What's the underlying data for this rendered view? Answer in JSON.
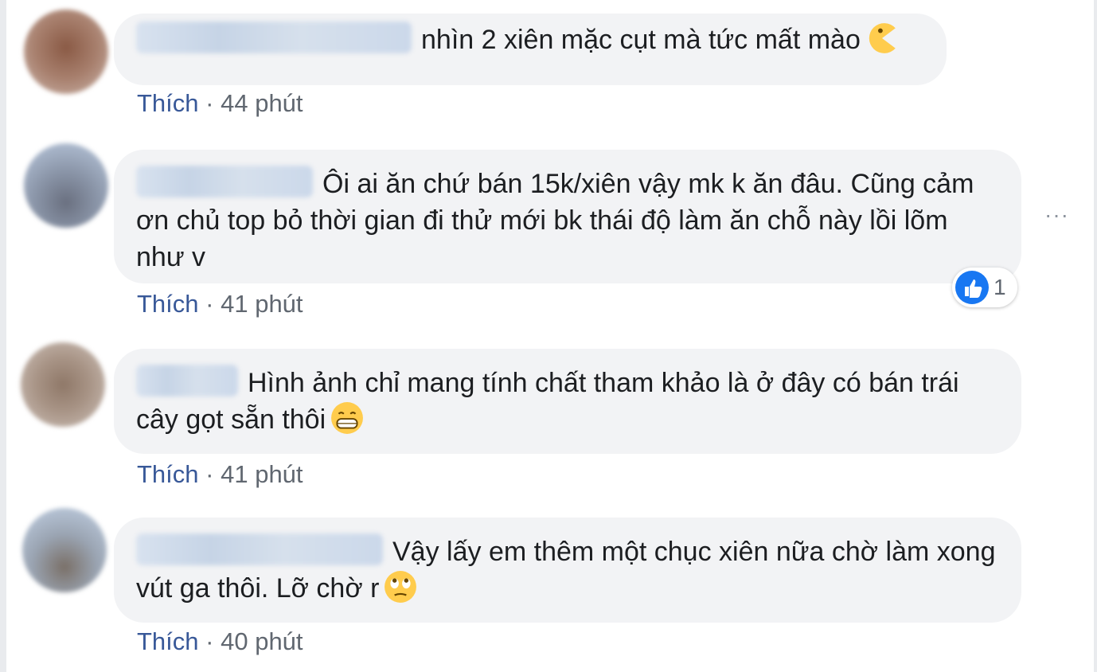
{
  "comments": [
    {
      "text": "nhìn 2 xiên mặc cụt mà tức mất mào",
      "emoji": "pacman-emoji",
      "like_label": "Thích",
      "sep": "·",
      "time": "44 phút"
    },
    {
      "text": "Ôi ai ăn chứ bán 15k/xiên vậy mk k ăn đâu. Cũng cảm ơn chủ top bỏ thời gian đi thử mới bk thái độ làm ăn chỗ này lồi lõm như v",
      "like_label": "Thích",
      "sep": "·",
      "time": "41 phút",
      "reaction": {
        "icon": "like-thumb-icon",
        "count": "1"
      },
      "more": "···"
    },
    {
      "text": "Hình ảnh chỉ mang tính chất tham khảo là ở đây có bán trái cây gọt sẵn thôi",
      "emoji": "grinning-emoji",
      "like_label": "Thích",
      "sep": "·",
      "time": "41 phút"
    },
    {
      "text": "Vậy lấy em thêm một chục xiên nữa chờ làm xong vút ga thôi. Lỡ chờ r",
      "emoji": "eye-roll-emoji",
      "like_label": "Thích",
      "sep": "·",
      "time": "40 phút"
    }
  ],
  "colors": {
    "link": "#385898",
    "bubble": "#f2f3f5",
    "text": "#1c1e21",
    "meta": "#606770",
    "like_blue": "#1877f2"
  }
}
